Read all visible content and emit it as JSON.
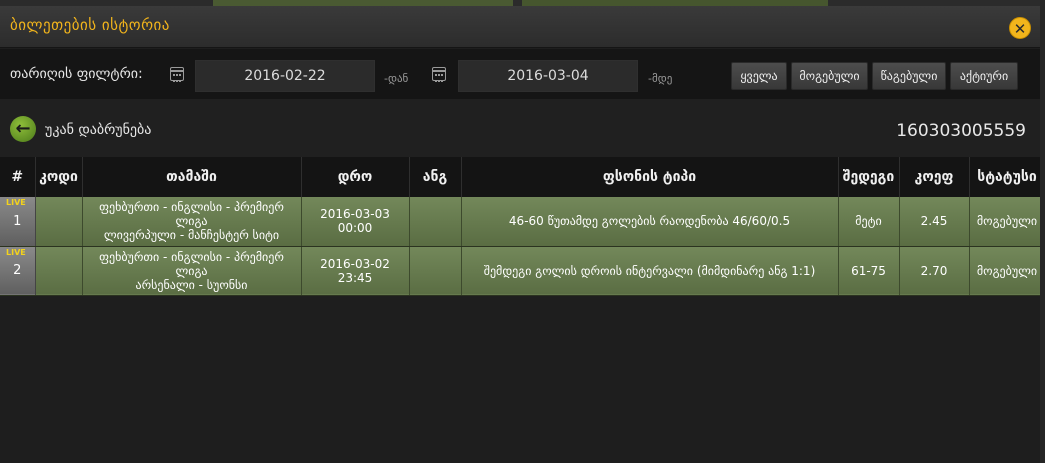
{
  "header": {
    "title": "ბილეთების ისტორია",
    "close_icon": "close-icon"
  },
  "filter": {
    "label": "თარიღის ფილტრი:",
    "from_date": "2016-02-22",
    "from_suffix": "-დან",
    "to_date": "2016-03-04",
    "to_suffix": "-მდე",
    "buttons": [
      "ყველა",
      "მოგებული",
      "წაგებული",
      "აქტიური"
    ]
  },
  "back": {
    "label": "უკან დაბრუნება",
    "ticket_id": "160303005559"
  },
  "table": {
    "headers": [
      "#",
      "კოდი",
      "თამაში",
      "დრო",
      "ანგ",
      "ფსონის ტიპი",
      "შედეგი",
      "კოეფ",
      "სტატუსი"
    ],
    "rows": [
      {
        "live": "LIVE",
        "num": "1",
        "code": "",
        "game_line1": "ფეხბურთი - ინგლისი - პრემიერ ლიგა",
        "game_line2": "ლივერპული - მანჩესტერ სიტი",
        "time": "2016-03-03 00:00",
        "score": "",
        "bet_type": "46-60 წუთამდე გოლების რაოდენობა 46/60/0.5",
        "result": "მეტი",
        "odds": "2.45",
        "status": "მოგებული"
      },
      {
        "live": "LIVE",
        "num": "2",
        "code": "",
        "game_line1": "ფეხბურთი - ინგლისი - პრემიერ ლიგა",
        "game_line2": "არსენალი - სუონსი",
        "time": "2016-03-02 23:45",
        "score": "",
        "bet_type": "შემდეგი გოლის დროის ინტერვალი (მიმდინარე ანგ 1:1)",
        "result": "61-75",
        "odds": "2.70",
        "status": "მოგებული"
      }
    ]
  },
  "colors": {
    "accent": "#f2b51c",
    "row_green": "#73885a"
  }
}
